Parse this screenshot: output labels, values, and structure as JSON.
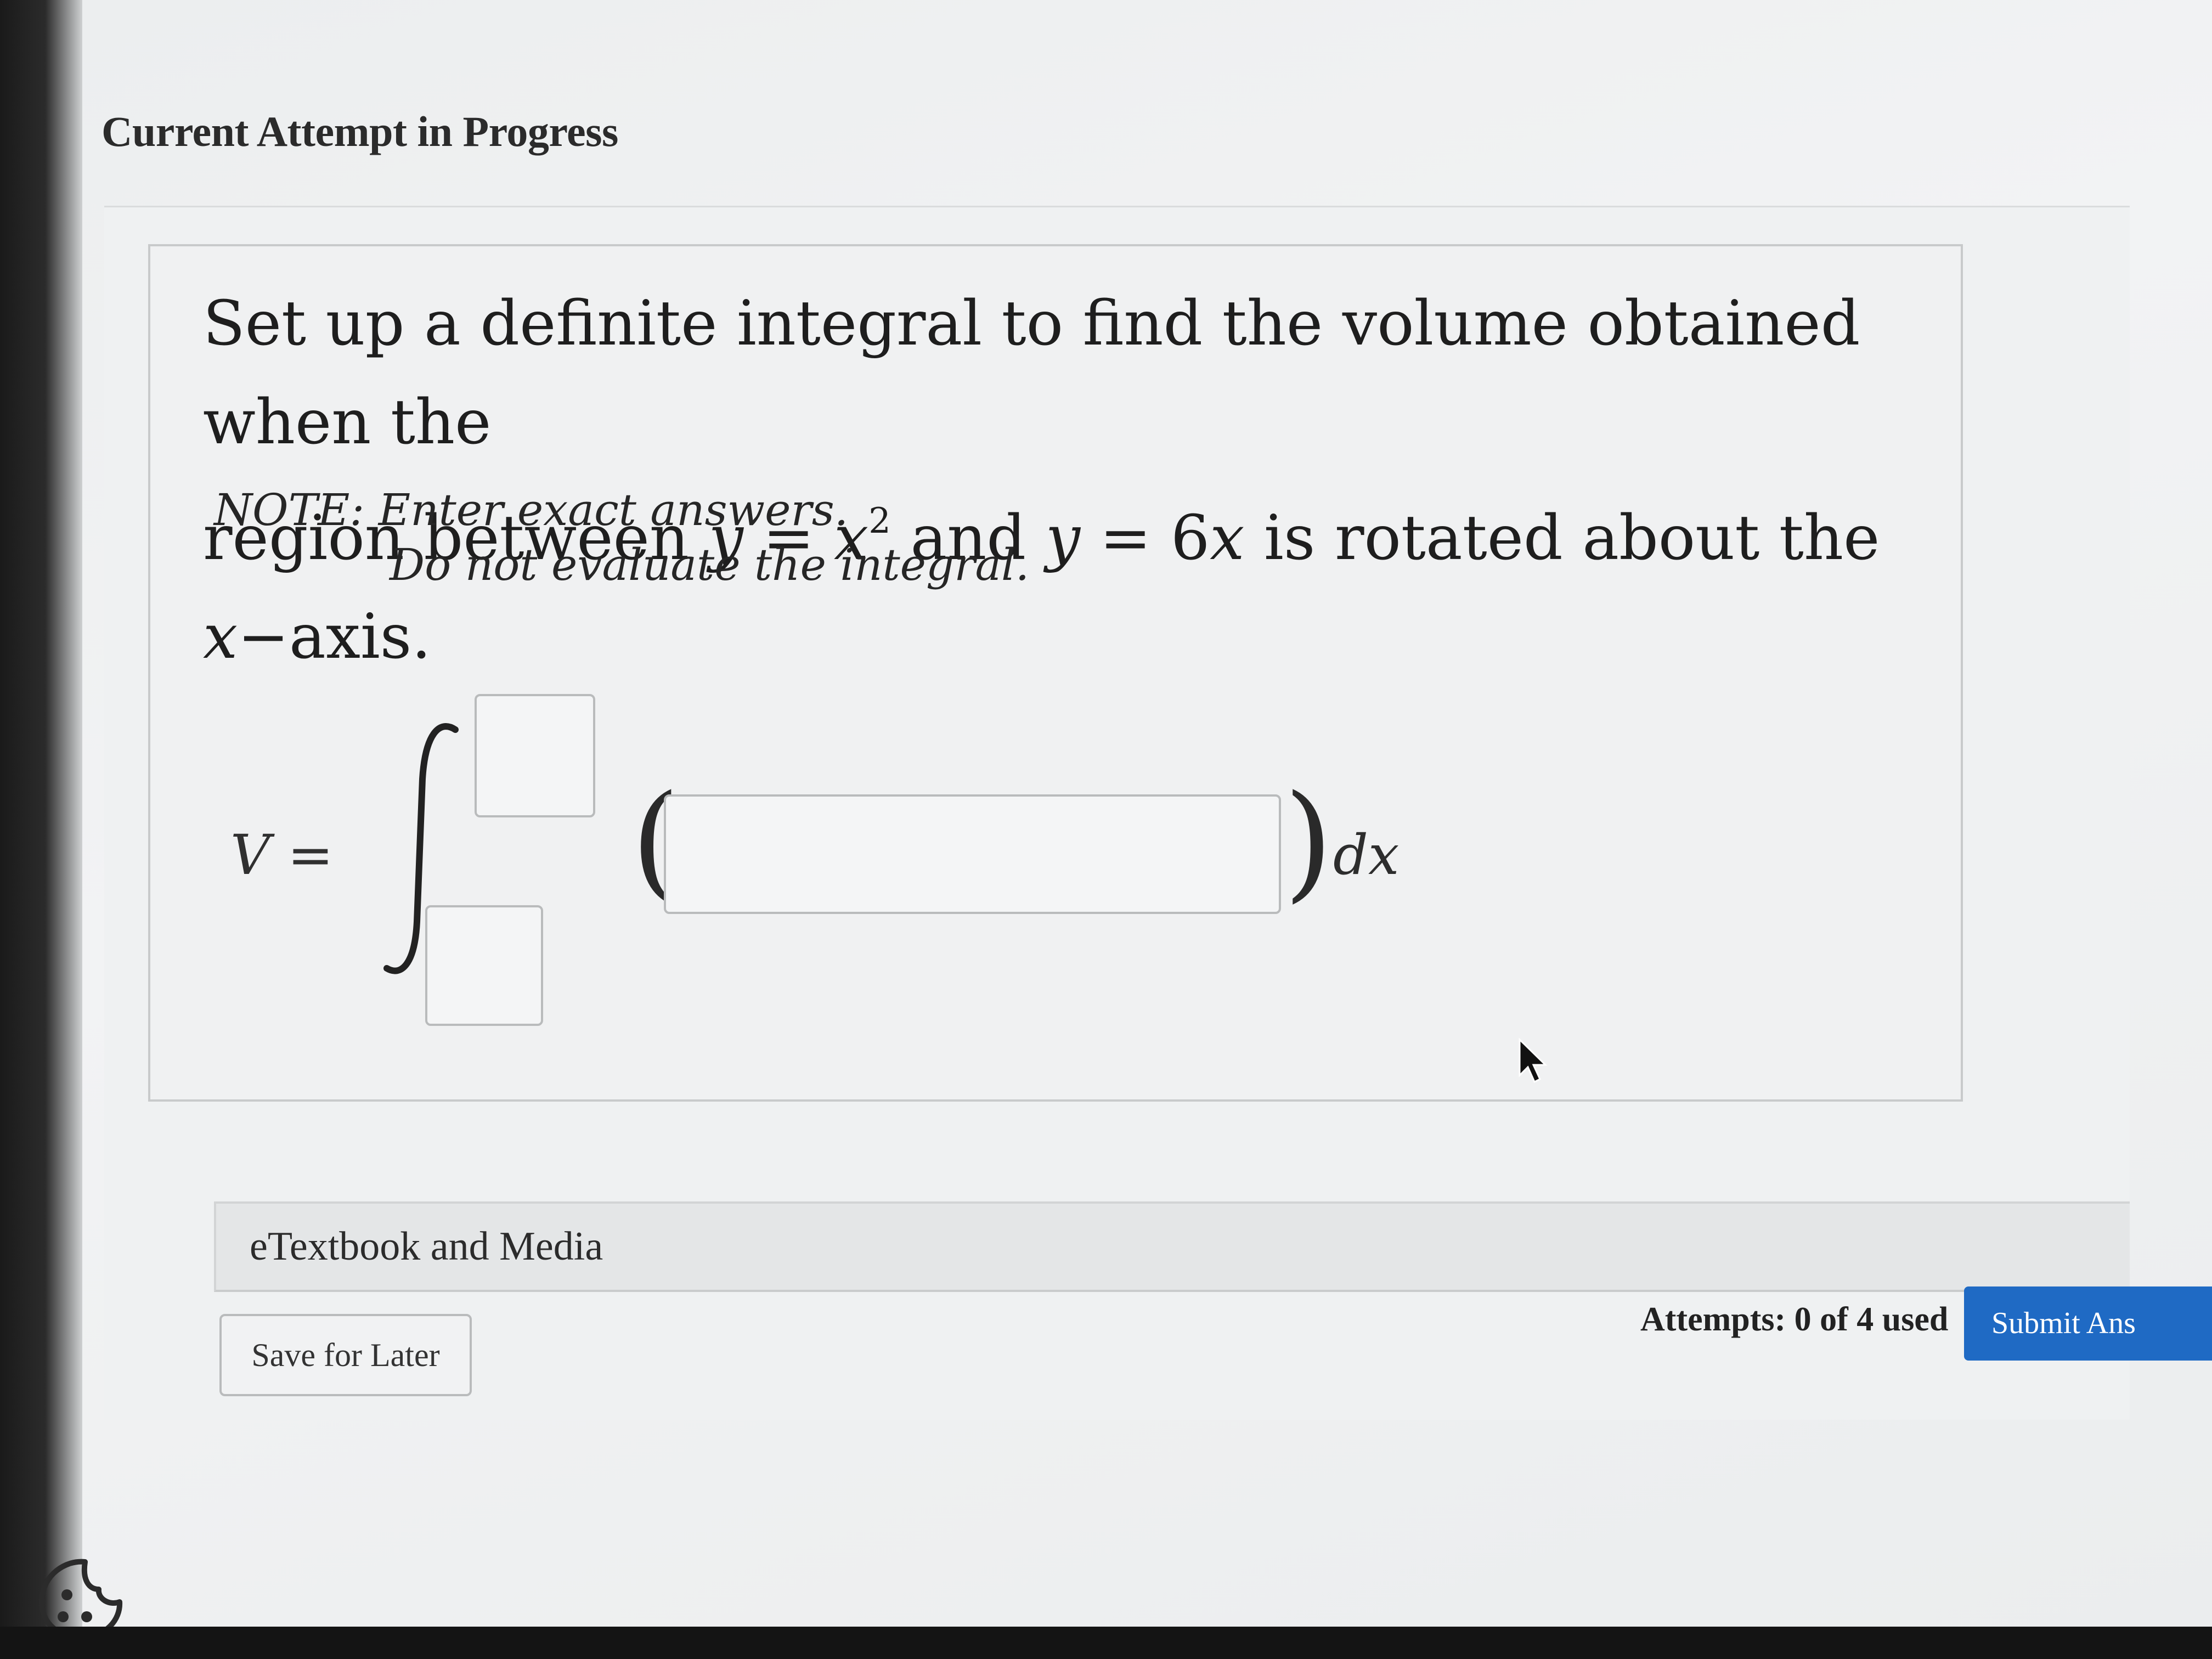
{
  "header": {
    "title": "Current Attempt in Progress"
  },
  "question": {
    "prompt_line1": "Set up a definite integral to find the volume obtained when the",
    "prompt_line2_a": "region between ",
    "curve1_lhs": "y",
    "curve1_eq": " = ",
    "curve1_base": "x",
    "curve1_exp": "2",
    "connector": " and ",
    "curve2_lhs": "y",
    "curve2_eq": " = 6",
    "curve2_var": "x",
    "prompt_line2_b": " is rotated about the ",
    "axis_var": "x",
    "axis_suffix": "−axis.",
    "note_line1": "NOTE: Enter exact answers.",
    "note_line2": "Do not evaluate the integral."
  },
  "answer": {
    "lhs_var": "V",
    "lhs_eq": " =",
    "open_paren": "(",
    "close_paren": ")",
    "differential": "dx",
    "upper_limit_value": "",
    "lower_limit_value": "",
    "integrand_value": ""
  },
  "resources": {
    "etextbook_label": "eTextbook and Media"
  },
  "footer": {
    "save_label": "Save for Later",
    "attempts_text": "Attempts: 0 of 4 used",
    "submit_label": "Submit Ans"
  },
  "icons": {
    "cookie": "cookie-icon",
    "cursor": "mouse-pointer-icon"
  },
  "colors": {
    "submit_bg": "#1f6ac4",
    "page_bg": "#eff1f2"
  }
}
